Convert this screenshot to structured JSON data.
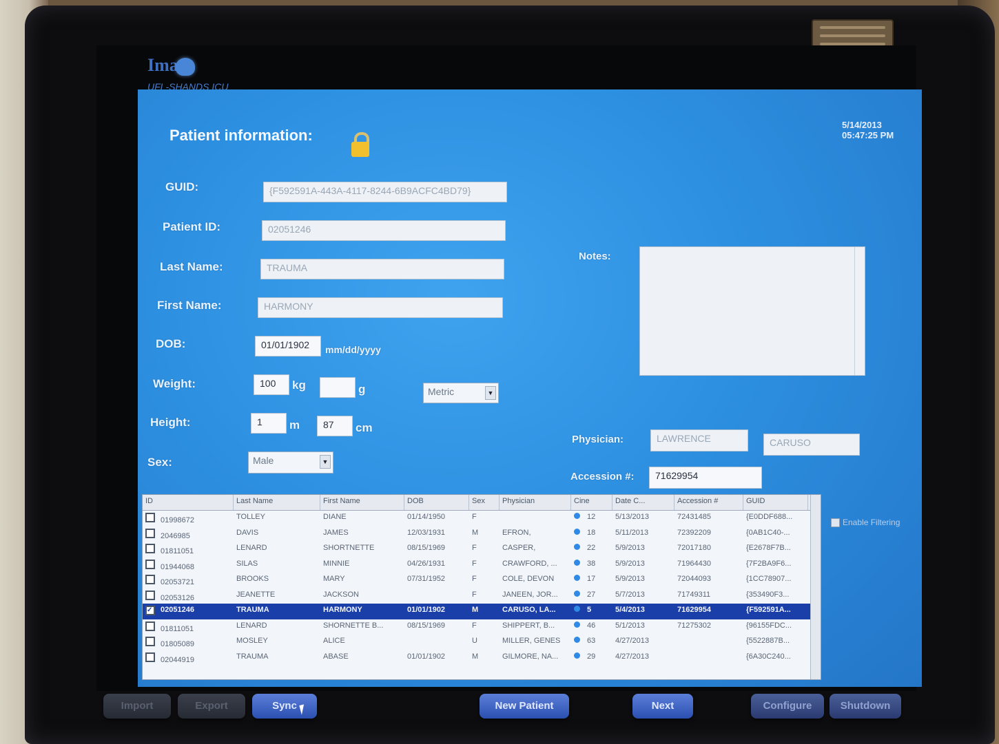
{
  "app": {
    "logo": "Ima",
    "unit": "UFL-SHANDS ICU"
  },
  "clock": {
    "date": "5/14/2013",
    "time": "05:47:25 PM"
  },
  "form": {
    "title": "Patient information:",
    "guid": {
      "label": "GUID:",
      "value": "{F592591A-443A-4117-8244-6B9ACFC4BD79}"
    },
    "patient_id": {
      "label": "Patient ID:",
      "value": "02051246"
    },
    "last_name": {
      "label": "Last Name:",
      "value": "TRAUMA"
    },
    "first_name": {
      "label": "First Name:",
      "value": "HARMONY"
    },
    "dob": {
      "label": "DOB:",
      "value": "01/01/1902",
      "hint": "mm/dd/yyyy"
    },
    "weight": {
      "label": "Weight:",
      "kg": "100",
      "kg_unit": "kg",
      "g": "",
      "g_unit": "g",
      "units": "Metric"
    },
    "height": {
      "label": "Height:",
      "m": "1",
      "m_unit": "m",
      "cm": "87",
      "cm_unit": "cm"
    },
    "sex": {
      "label": "Sex:",
      "value": "Male"
    },
    "notes": {
      "label": "Notes:"
    },
    "physician": {
      "label": "Physician:",
      "first": "LAWRENCE",
      "last": "CARUSO"
    },
    "accession": {
      "label": "Accession #:",
      "value": "71629954"
    }
  },
  "grid": {
    "columns": [
      "ID",
      "Last Name",
      "First Name",
      "DOB",
      "Sex",
      "Physician",
      "Cine",
      "Date C...",
      "Accession #",
      "GUID"
    ],
    "rows": [
      {
        "checked": false,
        "id": "01998672",
        "last": "TOLLEY",
        "first": "DIANE",
        "dob": "01/14/1950",
        "sex": "F",
        "physician": "",
        "cine": "12",
        "date": "5/13/2013",
        "acc": "72431485",
        "guid": "{E0DDF688..."
      },
      {
        "checked": false,
        "id": "2046985",
        "last": "DAVIS",
        "first": "JAMES",
        "dob": "12/03/1931",
        "sex": "M",
        "physician": "EFRON,",
        "cine": "18",
        "date": "5/11/2013",
        "acc": "72392209",
        "guid": "{0AB1C40-..."
      },
      {
        "checked": false,
        "id": "01811051",
        "last": "LENARD",
        "first": "SHORTNETTE",
        "dob": "08/15/1969",
        "sex": "F",
        "physician": "CASPER,",
        "cine": "22",
        "date": "5/9/2013",
        "acc": "72017180",
        "guid": "{E2678F7B..."
      },
      {
        "checked": false,
        "id": "01944068",
        "last": "SILAS",
        "first": "MINNIE",
        "dob": "04/26/1931",
        "sex": "F",
        "physician": "CRAWFORD, ...",
        "cine": "38",
        "date": "5/9/2013",
        "acc": "71964430",
        "guid": "{7F2BA9F6..."
      },
      {
        "checked": false,
        "id": "02053721",
        "last": "BROOKS",
        "first": "MARY",
        "dob": "07/31/1952",
        "sex": "F",
        "physician": "COLE, DEVON",
        "cine": "17",
        "date": "5/9/2013",
        "acc": "72044093",
        "guid": "{1CC78907..."
      },
      {
        "checked": false,
        "id": "02053126",
        "last": "JEANETTE",
        "first": "JACKSON",
        "dob": "",
        "sex": "F",
        "physician": "JANEEN, JOR...",
        "cine": "27",
        "date": "5/7/2013",
        "acc": "71749311",
        "guid": "{353490F3..."
      },
      {
        "checked": true,
        "id": "02051246",
        "last": "TRAUMA",
        "first": "HARMONY",
        "dob": "01/01/1902",
        "sex": "M",
        "physician": "CARUSO, LA...",
        "cine": "5",
        "date": "5/4/2013",
        "acc": "71629954",
        "guid": "{F592591A..."
      },
      {
        "checked": false,
        "id": "01811051",
        "last": "LENARD",
        "first": "SHORNETTE B...",
        "dob": "08/15/1969",
        "sex": "F",
        "physician": "SHIPPERT, B...",
        "cine": "46",
        "date": "5/1/2013",
        "acc": "71275302",
        "guid": "{96155FDC..."
      },
      {
        "checked": false,
        "id": "01805089",
        "last": "MOSLEY",
        "first": "ALICE",
        "dob": "",
        "sex": "U",
        "physician": "MILLER, GENES",
        "cine": "63",
        "date": "4/27/2013",
        "acc": "",
        "guid": "{5522887B..."
      },
      {
        "checked": false,
        "id": "02044919",
        "last": "TRAUMA",
        "first": "ABASE",
        "dob": "01/01/1902",
        "sex": "M",
        "physician": "GILMORE, NA...",
        "cine": "29",
        "date": "4/27/2013",
        "acc": "",
        "guid": "{6A30C240..."
      }
    ]
  },
  "filter": {
    "label": "Enable Filtering"
  },
  "buttons": {
    "import": "Import",
    "export": "Export",
    "sync": "Sync",
    "new_patient": "New Patient",
    "next": "Next",
    "configure": "Configure",
    "shutdown": "Shutdown"
  }
}
